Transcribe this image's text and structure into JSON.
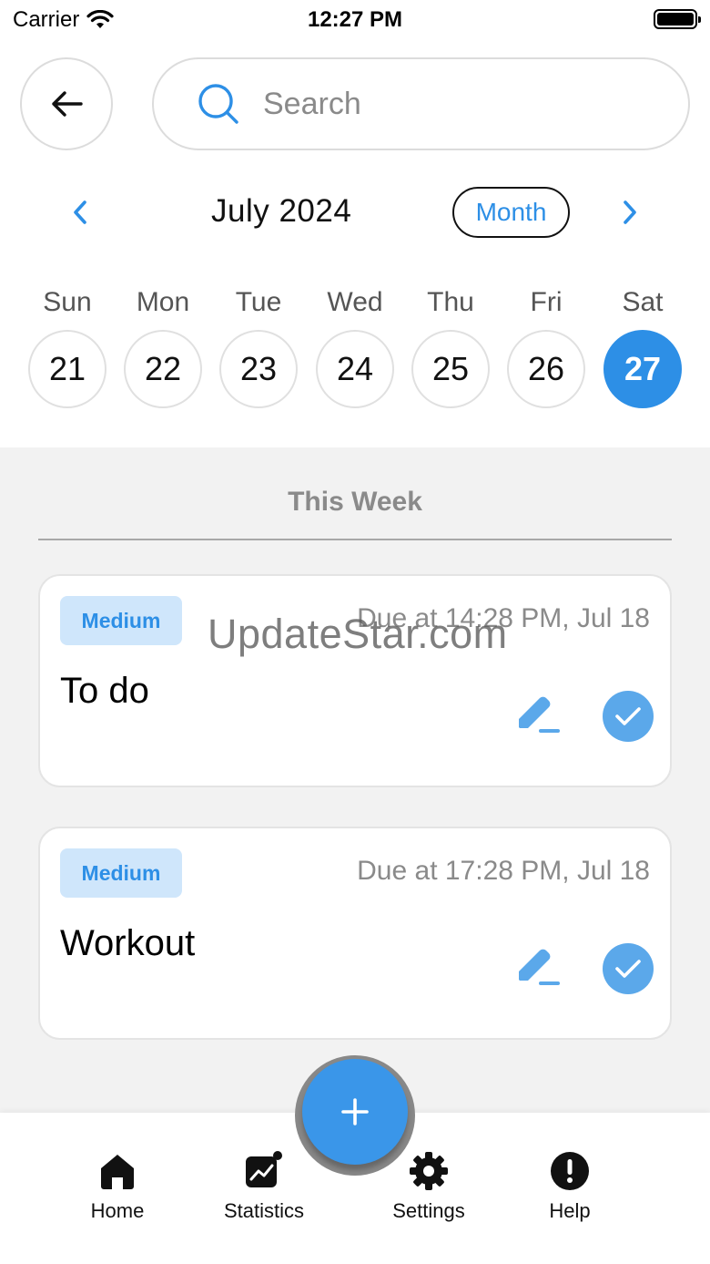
{
  "status_bar": {
    "carrier": "Carrier",
    "time": "12:27 PM"
  },
  "search": {
    "placeholder": "Search"
  },
  "calendar": {
    "month_label": "July 2024",
    "view_toggle": "Month",
    "days": [
      {
        "name": "Sun",
        "date": "21",
        "selected": false
      },
      {
        "name": "Mon",
        "date": "22",
        "selected": false
      },
      {
        "name": "Tue",
        "date": "23",
        "selected": false
      },
      {
        "name": "Wed",
        "date": "24",
        "selected": false
      },
      {
        "name": "Thu",
        "date": "25",
        "selected": false
      },
      {
        "name": "Fri",
        "date": "26",
        "selected": false
      },
      {
        "name": "Sat",
        "date": "27",
        "selected": true
      }
    ]
  },
  "section": {
    "title": "This Week"
  },
  "tasks": [
    {
      "priority": "Medium",
      "due": "Due at 14:28 PM, Jul 18",
      "title": "To do"
    },
    {
      "priority": "Medium",
      "due": "Due at 17:28 PM, Jul 18",
      "title": "Workout"
    }
  ],
  "watermark": "UpdateStar.com",
  "nav": [
    {
      "label": "Home",
      "icon": "home-icon"
    },
    {
      "label": "Statistics",
      "icon": "statistics-icon"
    },
    {
      "label": "Settings",
      "icon": "gear-icon"
    },
    {
      "label": "Help",
      "icon": "help-icon"
    }
  ],
  "colors": {
    "accent": "#2d8fe6",
    "badge_bg": "#cfe6fb",
    "content_bg": "#f2f2f2"
  }
}
